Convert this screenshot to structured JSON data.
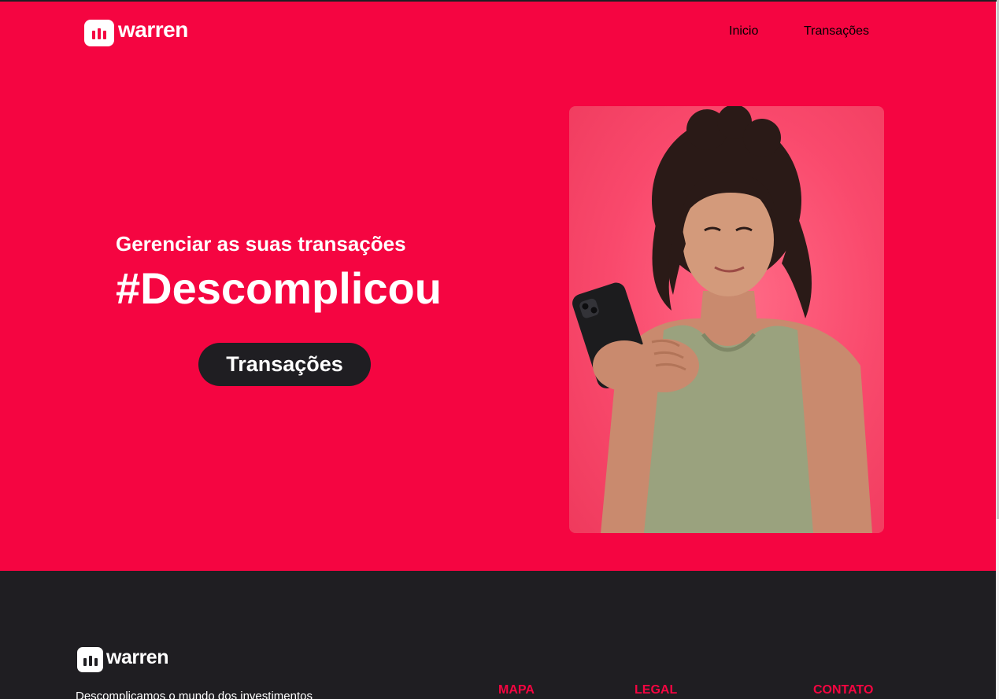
{
  "header": {
    "brand": "warren",
    "nav": [
      {
        "label": "Inicio"
      },
      {
        "label": "Transações"
      }
    ]
  },
  "hero": {
    "subtitle": "Gerenciar as suas transações",
    "title": "#Descomplicou",
    "cta_label": "Transações",
    "image_alt": "woman-smiling-holding-phone"
  },
  "footer": {
    "brand": "warren",
    "tagline": "Descomplicamos o mundo dos investimentos",
    "columns": [
      {
        "heading": "MAPA"
      },
      {
        "heading": "LEGAL"
      },
      {
        "heading": "CONTATO"
      }
    ]
  },
  "colors": {
    "brand_red": "#f50541",
    "dark": "#1f1e22",
    "white": "#ffffff"
  }
}
